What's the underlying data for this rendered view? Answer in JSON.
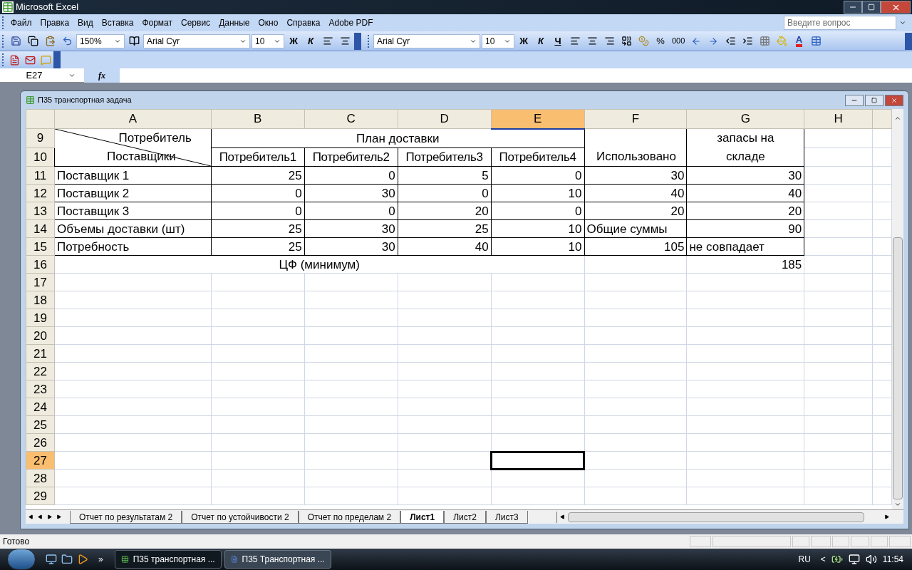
{
  "window": {
    "title": "Microsoft Excel"
  },
  "menu": [
    "Файл",
    "Правка",
    "Вид",
    "Вставка",
    "Формат",
    "Сервис",
    "Данные",
    "Окно",
    "Справка",
    "Adobe PDF"
  ],
  "help_search": {
    "placeholder": "Введите вопрос"
  },
  "toolbar": {
    "zoom": "150%",
    "font": "Arial Cyr",
    "size": "10",
    "bold": "Ж",
    "italic": "К"
  },
  "format_toolbar": {
    "font": "Arial Cyr",
    "size": "10",
    "bold": "Ж",
    "italic": "К",
    "underline": "Ч",
    "percent": "%",
    "thousands": "000",
    "font_color": "A"
  },
  "formula_bar": {
    "name_box": "E27",
    "fx": "fx"
  },
  "workbook": {
    "title": "П35 транспортная задача",
    "columns": [
      {
        "label": "A",
        "selected": false
      },
      {
        "label": "B",
        "selected": false
      },
      {
        "label": "C",
        "selected": false
      },
      {
        "label": "D",
        "selected": false
      },
      {
        "label": "E",
        "selected": true
      },
      {
        "label": "F",
        "selected": false
      },
      {
        "label": "G",
        "selected": false
      },
      {
        "label": "H",
        "selected": false
      }
    ],
    "rows": [
      {
        "number": "9",
        "selected": false,
        "bordered": true,
        "cells": [
          {
            "kind": "diagonal",
            "top": "Потребитель",
            "bottom": "Поставщики"
          },
          {
            "kind": "group",
            "text": "План доставки"
          },
          {
            "kind": "tall",
            "text": "Использовано"
          },
          {
            "kind": "tall",
            "text": "запасы на складе"
          }
        ]
      },
      {
        "number": "10",
        "selected": false,
        "bordered": true,
        "cells": [
          {
            "kind": "center",
            "text": "Потребитель1"
          },
          {
            "kind": "center",
            "text": "Потребитель2"
          },
          {
            "kind": "center",
            "text": "Потребитель3"
          },
          {
            "kind": "center",
            "text": "Потребитель4"
          }
        ]
      },
      {
        "number": "11",
        "selected": false,
        "bordered": true,
        "cells": [
          {
            "kind": "label",
            "text": "Поставщик 1"
          },
          {
            "kind": "number",
            "text": "25"
          },
          {
            "kind": "number",
            "text": "0"
          },
          {
            "kind": "number",
            "text": "5"
          },
          {
            "kind": "number",
            "text": "0"
          },
          {
            "kind": "number",
            "text": "30"
          },
          {
            "kind": "number",
            "text": "30"
          }
        ]
      },
      {
        "number": "12",
        "selected": false,
        "bordered": true,
        "cells": [
          {
            "kind": "label",
            "text": "Поставщик 2"
          },
          {
            "kind": "number",
            "text": "0"
          },
          {
            "kind": "number",
            "text": "30"
          },
          {
            "kind": "number",
            "text": "0"
          },
          {
            "kind": "number",
            "text": "10"
          },
          {
            "kind": "number",
            "text": "40"
          },
          {
            "kind": "number",
            "text": "40"
          }
        ]
      },
      {
        "number": "13",
        "selected": false,
        "bordered": true,
        "cells": [
          {
            "kind": "label",
            "text": "Поставщик 3"
          },
          {
            "kind": "number",
            "text": "0"
          },
          {
            "kind": "number",
            "text": "0"
          },
          {
            "kind": "number",
            "text": "20"
          },
          {
            "kind": "number",
            "text": "0"
          },
          {
            "kind": "number",
            "text": "20"
          },
          {
            "kind": "number",
            "text": "20"
          }
        ]
      },
      {
        "number": "14",
        "selected": false,
        "bordered": true,
        "cells": [
          {
            "kind": "label",
            "text": "Объемы доставки (шт)"
          },
          {
            "kind": "number",
            "text": "25"
          },
          {
            "kind": "number",
            "text": "30"
          },
          {
            "kind": "number",
            "text": "25"
          },
          {
            "kind": "number",
            "text": "10"
          },
          {
            "kind": "label",
            "text": "Общие суммы"
          },
          {
            "kind": "number",
            "text": "90"
          }
        ]
      },
      {
        "number": "15",
        "selected": false,
        "bordered": true,
        "cells": [
          {
            "kind": "label",
            "text": "Потребность"
          },
          {
            "kind": "number",
            "text": "25"
          },
          {
            "kind": "number",
            "text": "30"
          },
          {
            "kind": "number",
            "text": "40"
          },
          {
            "kind": "number",
            "text": "10"
          },
          {
            "kind": "number",
            "text": "105"
          },
          {
            "kind": "label",
            "text": "не совпадает"
          }
        ]
      },
      {
        "number": "16",
        "selected": false,
        "bordered": false,
        "cells": [
          {
            "kind": "wide",
            "text": "ЦФ (минимум)"
          },
          {
            "kind": "blank"
          },
          {
            "kind": "number",
            "text": "185"
          }
        ]
      },
      {
        "number": "17",
        "selected": false
      },
      {
        "number": "18",
        "selected": false
      },
      {
        "number": "19",
        "selected": false
      },
      {
        "number": "20",
        "selected": false
      },
      {
        "number": "21",
        "selected": false
      },
      {
        "number": "22",
        "selected": false
      },
      {
        "number": "23",
        "selected": false
      },
      {
        "number": "24",
        "selected": false
      },
      {
        "number": "25",
        "selected": false
      },
      {
        "number": "26",
        "selected": false
      },
      {
        "number": "27",
        "selected": true
      },
      {
        "number": "28",
        "selected": false
      },
      {
        "number": "29",
        "selected": false
      }
    ],
    "sheets": [
      {
        "label": "Отчет по результатам 2",
        "selected": false
      },
      {
        "label": "Отчет по устойчивости 2",
        "selected": false
      },
      {
        "label": "Отчет по пределам 2",
        "selected": false
      },
      {
        "label": "Лист1",
        "selected": true
      },
      {
        "label": "Лист2",
        "selected": false
      },
      {
        "label": "Лист3",
        "selected": false
      }
    ]
  },
  "status_bar": {
    "text": "Готово"
  },
  "taskbar": {
    "more": "»",
    "items": [
      {
        "label": "П35 транспортная ...",
        "kind": "excel",
        "selected": true
      },
      {
        "label": "П35 Транспортная ...",
        "kind": "word",
        "selected": false
      }
    ],
    "language": "RU",
    "tray_toggle": "<",
    "time": "11:54"
  }
}
